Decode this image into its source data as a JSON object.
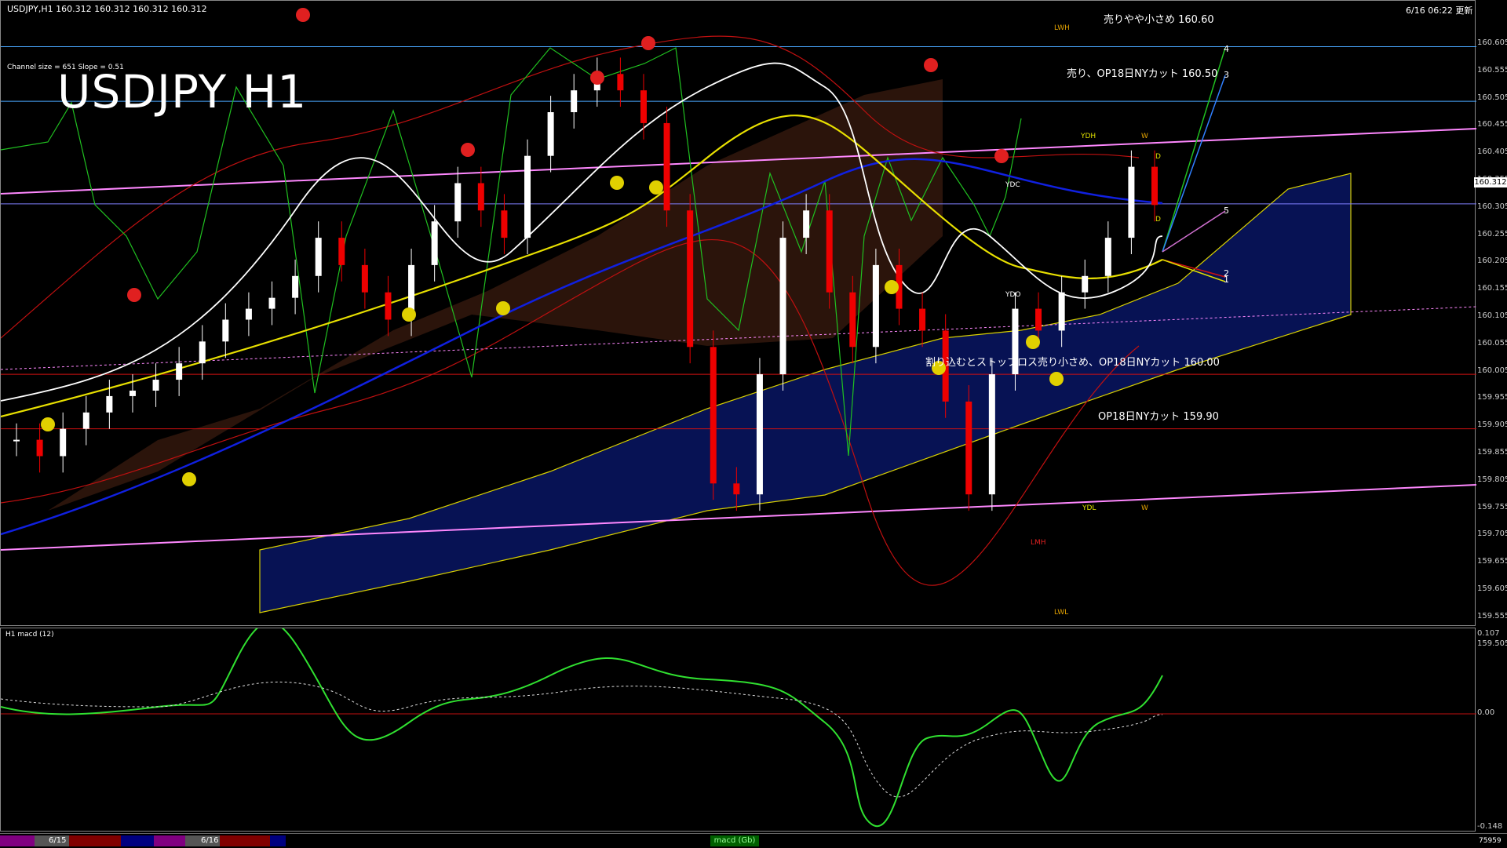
{
  "header": {
    "symbol_line": "USDJPY,H1  160.312 160.312 160.312 160.312",
    "channel_info": "Channel size = 651 Slope = 0.51",
    "datetime": "6/16 06:22 更新"
  },
  "title": "USDJPY H1",
  "annotations": {
    "sell_small_top": "売りやや小さめ 160.60",
    "sell_op18": "売り、OP18日NYカット 160.50",
    "dip_sell_small": "割り込むとストップロス売り小さめ、OP18日NYカット 160.00",
    "op18_15990": "OP18日NYカット 159.90"
  },
  "level_labels": {
    "lwh": "LWH",
    "lmh": "LMH",
    "ydh": "YDH",
    "ydl": "YDL",
    "ydc": "YDC",
    "ydo": "YDO",
    "lml": "LMH",
    "lwl": "LWL",
    "w1": "W",
    "w2": "W",
    "d1": "D",
    "d2": "D",
    "n4": "4",
    "n3": "3",
    "n5": "5",
    "n2": "2",
    "n1": "1"
  },
  "price_axis": {
    "ticks": [
      "160.605",
      "160.555",
      "160.505",
      "160.455",
      "160.405",
      "160.355",
      "160.305",
      "160.255",
      "160.205",
      "160.155",
      "160.105",
      "160.055",
      "160.005",
      "159.955",
      "159.905",
      "159.855",
      "159.805",
      "159.755",
      "159.705",
      "159.655",
      "159.605",
      "159.555",
      "159.505"
    ],
    "current_price": "160.312"
  },
  "macd": {
    "label": "H1  macd (12)",
    "axis_ticks": [
      "0.107",
      "0.00",
      "-0.148"
    ]
  },
  "bottom_bar": {
    "date1": "6/15",
    "date2": "6/16",
    "tab_label": "macd (Gb)",
    "right_text": "75959"
  },
  "chart_data": {
    "type": "line",
    "title": "USDJPY H1",
    "series": [
      {
        "name": "",
        "values": [
          159.88,
          159.85,
          159.9,
          159.93,
          159.96,
          159.97,
          159.99,
          160.02,
          160.06,
          160.1,
          160.12,
          160.14,
          160.18,
          160.25,
          160.2,
          160.15,
          160.1,
          160.2,
          160.28,
          160.35,
          160.3,
          160.25,
          160.4,
          160.48,
          160.52,
          160.55,
          160.52,
          160.46,
          160.3,
          160.05,
          159.8,
          159.78,
          160.0,
          160.25,
          160.3,
          160.15,
          160.05,
          160.2,
          160.12,
          160.08,
          159.95,
          159.78,
          160.0,
          160.12,
          160.08,
          160.15,
          160.18,
          160.25,
          160.38,
          160.31
        ]
      }
    ],
    "ylim": [
      159.505,
      160.605
    ]
  }
}
